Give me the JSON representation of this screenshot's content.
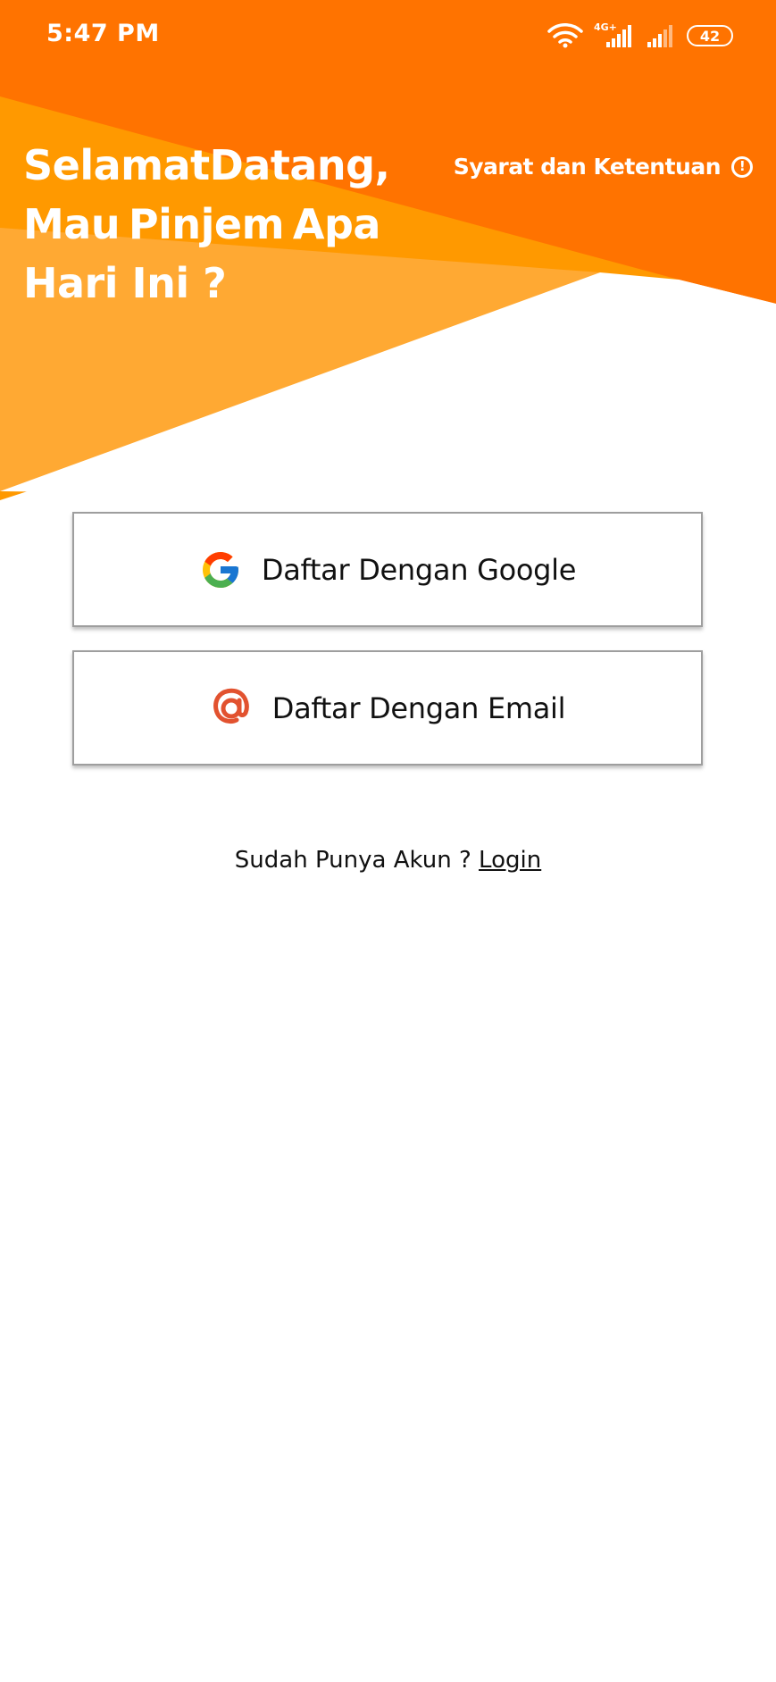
{
  "status_bar": {
    "time": "5:47 PM",
    "network_label": "4G+",
    "battery": "42",
    "icons": [
      "wifi-icon",
      "signal-icon",
      "signal-icon",
      "battery-icon"
    ]
  },
  "header": {
    "welcome_line1_a": "Selamat",
    "welcome_line1_b": "Datang,",
    "welcome_line2_a": "Mau",
    "welcome_line2_b": "Pinjem",
    "welcome_line2_c": "Apa",
    "welcome_line3": "Hari Ini ?",
    "terms_label": "Syarat dan Ketentuan",
    "terms_icon": "!"
  },
  "buttons": {
    "google_label": "Daftar Dengan Google",
    "email_label": "Daftar Dengan Email"
  },
  "footer": {
    "prompt": "Sudah Punya Akun ? ",
    "login_label": "Login"
  },
  "colors": {
    "orange_dark": "#FF7300",
    "orange_mid": "#FF9A00",
    "orange_light": "#FFAA30",
    "email_icon": "#E2522F"
  }
}
